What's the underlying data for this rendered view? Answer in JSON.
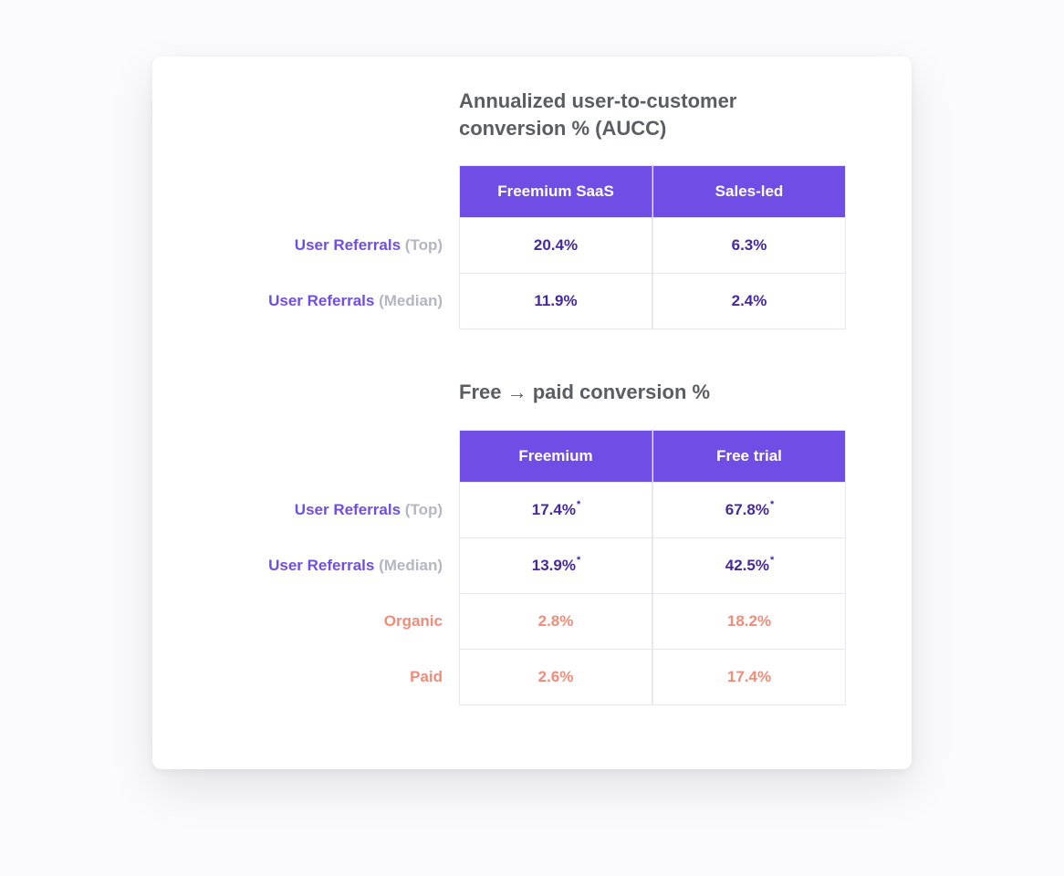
{
  "table1": {
    "title": "Annualized user-to-customer conversion % (AUCC)",
    "cols": [
      "Freemium SaaS",
      "Sales-led"
    ],
    "rows": [
      {
        "label_main": "User Referrals",
        "label_sub": "(Top)",
        "values": [
          "20.4%",
          "6.3%"
        ],
        "style": "purple",
        "ast": [
          false,
          false
        ]
      },
      {
        "label_main": "User Referrals",
        "label_sub": "(Median)",
        "values": [
          "11.9%",
          "2.4%"
        ],
        "style": "purple",
        "ast": [
          false,
          false
        ]
      }
    ]
  },
  "table2": {
    "title": "Free → paid conversion %",
    "cols": [
      "Freemium",
      "Free trial"
    ],
    "rows": [
      {
        "label_main": "User Referrals",
        "label_sub": "(Top)",
        "values": [
          "17.4%",
          "67.8%"
        ],
        "style": "purple",
        "ast": [
          true,
          true
        ]
      },
      {
        "label_main": "User Referrals",
        "label_sub": "(Median)",
        "values": [
          "13.9%",
          "42.5%"
        ],
        "style": "purple",
        "ast": [
          true,
          true
        ]
      },
      {
        "label_main": "Organic",
        "label_sub": "",
        "values": [
          "2.8%",
          "18.2%"
        ],
        "style": "coral",
        "ast": [
          false,
          false
        ]
      },
      {
        "label_main": "Paid",
        "label_sub": "",
        "values": [
          "2.6%",
          "17.4%"
        ],
        "style": "coral",
        "ast": [
          false,
          false
        ]
      }
    ]
  },
  "chart_data": [
    {
      "type": "table",
      "title": "Annualized user-to-customer conversion % (AUCC)",
      "columns": [
        "Freemium SaaS",
        "Sales-led"
      ],
      "rows": [
        "User Referrals (Top)",
        "User Referrals (Median)"
      ],
      "values": [
        [
          20.4,
          6.3
        ],
        [
          11.9,
          2.4
        ]
      ],
      "unit": "%"
    },
    {
      "type": "table",
      "title": "Free → paid conversion %",
      "columns": [
        "Freemium",
        "Free trial"
      ],
      "rows": [
        "User Referrals (Top)",
        "User Referrals (Median)",
        "Organic",
        "Paid"
      ],
      "values": [
        [
          17.4,
          67.8
        ],
        [
          13.9,
          42.5
        ],
        [
          2.8,
          18.2
        ],
        [
          2.6,
          17.4
        ]
      ],
      "unit": "%",
      "annotations": [
        "rows 0-1 marked with asterisk"
      ]
    }
  ]
}
